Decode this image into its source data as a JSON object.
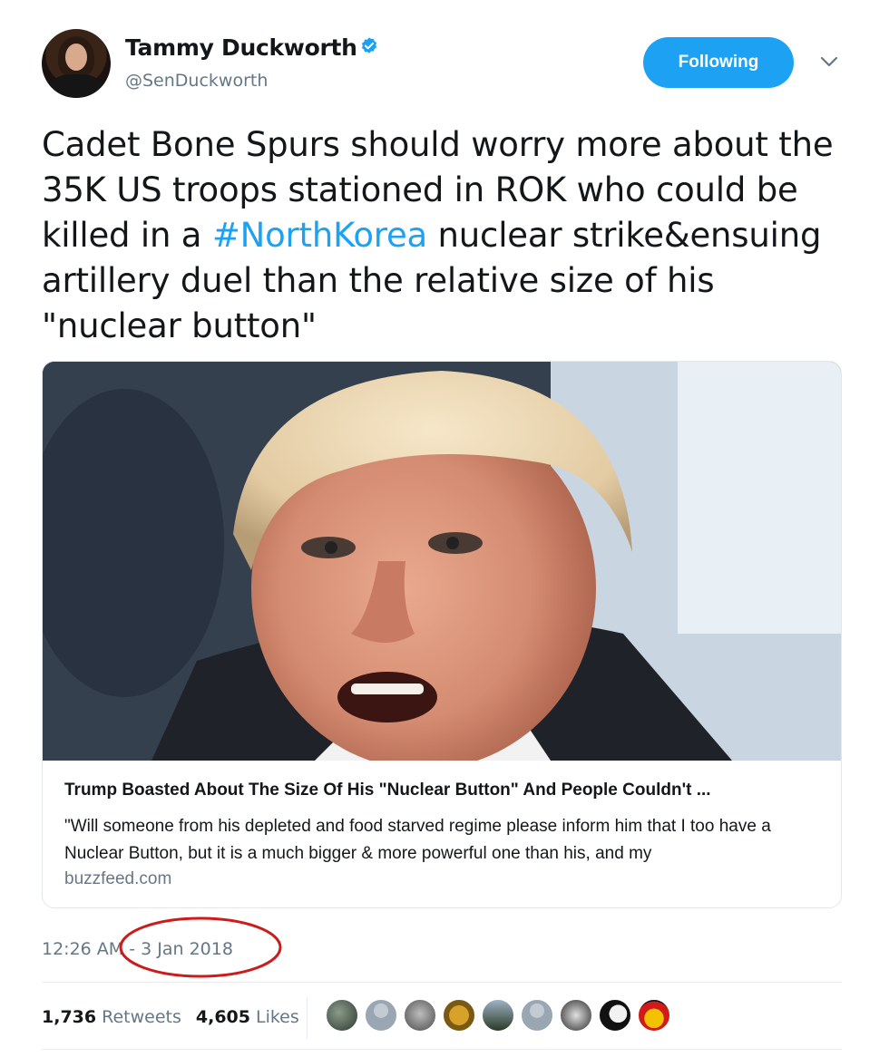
{
  "user": {
    "name": "Tammy Duckworth",
    "handle": "@SenDuckworth",
    "follow_label": "Following"
  },
  "tweet": {
    "text_before": "Cadet Bone Spurs should worry more about the 35K US troops stationed in ROK who could be killed in a ",
    "hashtag": "#NorthKorea",
    "text_after": " nuclear strike&ensuing artillery duel than the relative size of his \"nuclear button\""
  },
  "card": {
    "title": "Trump Boasted About The Size Of His \"Nuclear Button\" And People Couldn't ...",
    "description": "\"Will someone from his depleted and food starved regime please inform him that I too have a Nuclear Button, but it is a much bigger & more powerful one than his, and my",
    "domain": "buzzfeed.com"
  },
  "meta": {
    "timestamp": "12:26 AM - 3 Jan 2018",
    "retweets_count": "1,736",
    "retweets_label": "Retweets",
    "likes_count": "4,605",
    "likes_label": "Likes"
  },
  "colors": {
    "accent": "#1da1f2",
    "annotation": "#cc1b1b",
    "secondary_text": "#657786"
  },
  "icons": [
    "verified-badge-icon",
    "chevron-down-icon"
  ]
}
